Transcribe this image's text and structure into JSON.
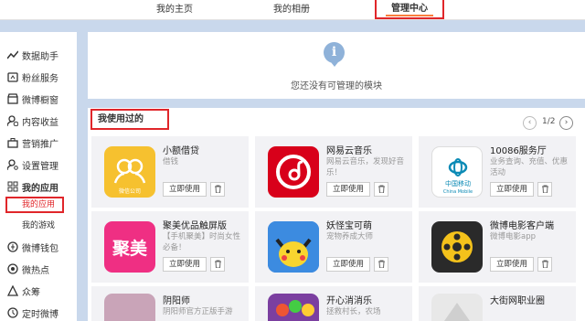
{
  "top_tabs": [
    "我的主页",
    "我的相册",
    "管理中心"
  ],
  "sidebar": {
    "items": [
      {
        "label": "数据助手",
        "icon": "line-chart-icon"
      },
      {
        "label": "粉丝服务",
        "icon": "fans-icon"
      },
      {
        "label": "微博橱窗",
        "icon": "shop-icon"
      },
      {
        "label": "内容收益",
        "icon": "user-coin-icon"
      },
      {
        "label": "营销推广",
        "icon": "briefcase-icon"
      },
      {
        "label": "设置管理",
        "icon": "user-settings-icon"
      },
      {
        "label": "我的应用",
        "icon": "apps-grid-icon"
      }
    ],
    "sub_items": [
      "我的应用",
      "我的游戏"
    ],
    "items2": [
      {
        "label": "微博钱包",
        "icon": "wallet-icon"
      },
      {
        "label": "微热点",
        "icon": "hotspot-icon"
      },
      {
        "label": "众筹",
        "icon": "crowdfunding-icon"
      },
      {
        "label": "定时微博",
        "icon": "clock-icon"
      }
    ]
  },
  "empty_state": {
    "icon": "info-icon",
    "text": "您还没有可管理的模块"
  },
  "used_section": {
    "title": "我使用过的",
    "page": "1/2"
  },
  "apps": [
    {
      "name": "小额借贷",
      "desc": "借钱",
      "icon_text": "微信公司",
      "color": "#f7c331"
    },
    {
      "name": "网易云音乐",
      "desc": "网易云音乐，发现好音乐！",
      "icon_text": "",
      "color": "#d8001a"
    },
    {
      "name": "10086服务厅",
      "desc": "业务查询、充值、优惠活动",
      "icon_text": "中国移动 China Mobile",
      "color": "#ffffff"
    },
    {
      "name": "聚美优品触屏版",
      "desc": "【手机聚美】时尚女性必备！",
      "icon_text": "聚美",
      "color": "#ef2f83"
    },
    {
      "name": "妖怪宝可萌",
      "desc": "宠物养成大师",
      "icon_text": "",
      "color": "#2e7bd6"
    },
    {
      "name": "微博电影客户端",
      "desc": "微博电影app",
      "icon_text": "",
      "color": "#2a2a2a"
    },
    {
      "name": "阴阳师",
      "desc": "阴阳师官方正版手游",
      "icon_text": "",
      "color": "#c9a4b8"
    },
    {
      "name": "开心消消乐",
      "desc": "拯救村长，农场",
      "icon_text": "",
      "color": "#7b3fa0"
    },
    {
      "name": "大街网职业圈",
      "desc": "",
      "icon_text": "",
      "color": "#e8e8e8"
    }
  ],
  "use_label": "立即使用"
}
